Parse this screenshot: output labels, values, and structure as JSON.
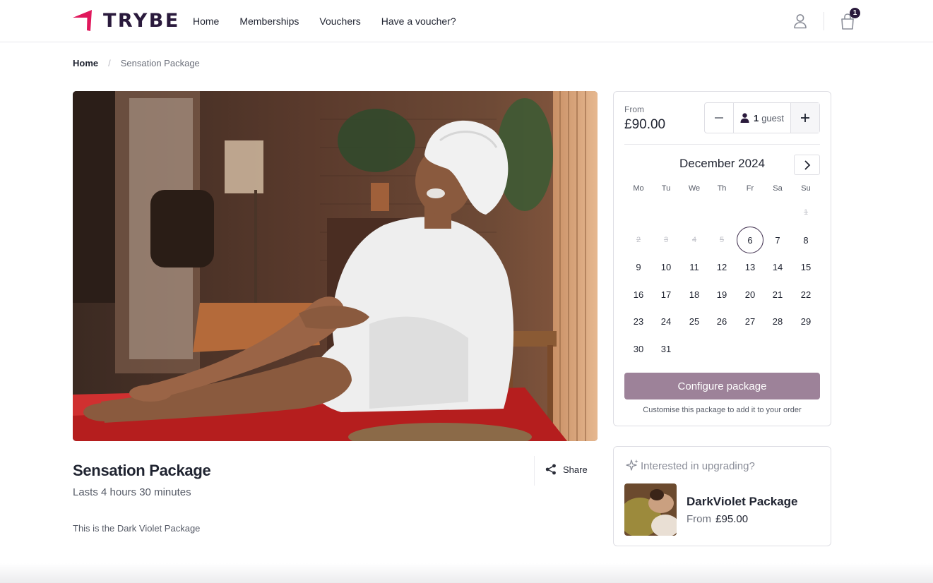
{
  "brand": {
    "name": "TRYBE",
    "accent": "#e0185c"
  },
  "nav": {
    "items": [
      {
        "label": "Home"
      },
      {
        "label": "Memberships"
      },
      {
        "label": "Vouchers"
      },
      {
        "label": "Have a voucher?"
      }
    ]
  },
  "header_icons": {
    "account": "user-icon",
    "cart": "shopping-bag-icon",
    "cart_count": "1"
  },
  "breadcrumb": {
    "home": "Home",
    "separator": "/",
    "current": "Sensation Package"
  },
  "package": {
    "title": "Sensation Package",
    "duration": "Lasts 4 hours 30 minutes",
    "description": "This is the Dark Violet Package",
    "share_label": "Share"
  },
  "booking": {
    "from_label": "From",
    "price": "£90.00",
    "guest_count": "1",
    "guest_label": "guest",
    "month": "December 2024",
    "weekdays": [
      "Mo",
      "Tu",
      "We",
      "Th",
      "Fr",
      "Sa",
      "Su"
    ],
    "selected_day": "6",
    "weeks": [
      [
        null,
        null,
        null,
        null,
        null,
        null,
        {
          "d": "1",
          "off": true
        }
      ],
      [
        {
          "d": "2",
          "off": true
        },
        {
          "d": "3",
          "off": true
        },
        {
          "d": "4",
          "off": true
        },
        {
          "d": "5",
          "off": true
        },
        {
          "d": "6"
        },
        {
          "d": "7"
        },
        {
          "d": "8"
        }
      ],
      [
        {
          "d": "9"
        },
        {
          "d": "10"
        },
        {
          "d": "11"
        },
        {
          "d": "12"
        },
        {
          "d": "13"
        },
        {
          "d": "14"
        },
        {
          "d": "15"
        }
      ],
      [
        {
          "d": "16"
        },
        {
          "d": "17"
        },
        {
          "d": "18"
        },
        {
          "d": "19"
        },
        {
          "d": "20"
        },
        {
          "d": "21"
        },
        {
          "d": "22"
        }
      ],
      [
        {
          "d": "23"
        },
        {
          "d": "24"
        },
        {
          "d": "25"
        },
        {
          "d": "26"
        },
        {
          "d": "27"
        },
        {
          "d": "28"
        },
        {
          "d": "29"
        }
      ],
      [
        {
          "d": "30"
        },
        {
          "d": "31"
        },
        null,
        null,
        null,
        null,
        null
      ]
    ],
    "configure_label": "Configure package",
    "configure_hint": "Customise this package to add it to your order",
    "button_color": "#9d8299"
  },
  "upgrade": {
    "heading": "Interested in upgrading?",
    "name": "DarkViolet Package",
    "from_label": "From",
    "price": "£95.00"
  }
}
